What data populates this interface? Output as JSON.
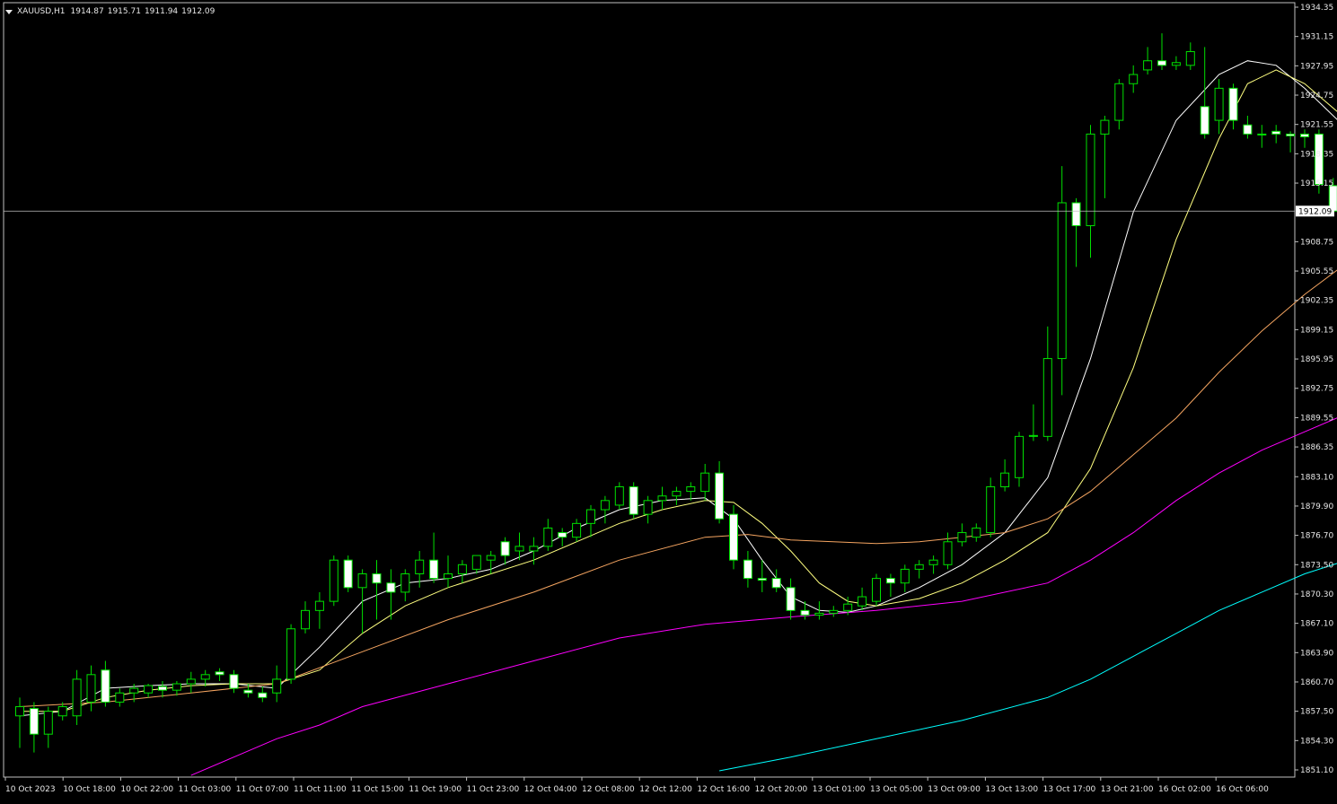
{
  "header": {
    "symbol": "XAUUSD,H1",
    "open": "1914.87",
    "high": "1915.71",
    "low": "1911.94",
    "close": "1912.09"
  },
  "colors": {
    "background": "#000000",
    "frame": "#c0c0c0",
    "bull_candle": "#00e000",
    "bear_candle_body": "#ffffff",
    "ma_fast": "#ffffff",
    "ma_slow": "#ffff80",
    "ma_50": "#f4a460",
    "ma_100": "#ff00ff",
    "ma_200": "#00ffff",
    "bid_line": "#c0c0c0"
  },
  "chart_data": {
    "type": "candlestick",
    "symbol": "XAUUSD",
    "timeframe": "H1",
    "ylim": [
      1851.1,
      1934.35
    ],
    "y_ticks": [
      "1934.35",
      "1931.15",
      "1927.95",
      "1924.75",
      "1921.55",
      "1918.35",
      "1915.15",
      "1912.09",
      "1908.75",
      "1905.55",
      "1902.35",
      "1899.15",
      "1895.95",
      "1892.75",
      "1889.55",
      "1886.35",
      "1883.10",
      "1879.90",
      "1876.70",
      "1873.50",
      "1870.30",
      "1867.10",
      "1863.90",
      "1860.70",
      "1857.50",
      "1854.30",
      "1851.10"
    ],
    "current_price": 1912.09,
    "x_labels": [
      "10 Oct 2023",
      "10 Oct 18:00",
      "10 Oct 22:00",
      "11 Oct 03:00",
      "11 Oct 07:00",
      "11 Oct 11:00",
      "11 Oct 15:00",
      "11 Oct 19:00",
      "11 Oct 23:00",
      "12 Oct 04:00",
      "12 Oct 08:00",
      "12 Oct 12:00",
      "12 Oct 16:00",
      "12 Oct 20:00",
      "13 Oct 01:00",
      "13 Oct 05:00",
      "13 Oct 09:00",
      "13 Oct 13:00",
      "13 Oct 17:00",
      "13 Oct 21:00",
      "16 Oct 02:00",
      "16 Oct 06:00"
    ],
    "candles": [
      {
        "o": 1857.0,
        "h": 1859.0,
        "l": 1853.5,
        "c": 1858.0
      },
      {
        "o": 1857.8,
        "h": 1858.5,
        "l": 1853.0,
        "c": 1855.0
      },
      {
        "o": 1855.0,
        "h": 1858.0,
        "l": 1853.5,
        "c": 1857.5
      },
      {
        "o": 1857.0,
        "h": 1858.5,
        "l": 1856.5,
        "c": 1858.0
      },
      {
        "o": 1857.0,
        "h": 1862.0,
        "l": 1856.0,
        "c": 1861.0
      },
      {
        "o": 1858.5,
        "h": 1862.5,
        "l": 1857.5,
        "c": 1861.5
      },
      {
        "o": 1862.0,
        "h": 1863.0,
        "l": 1858.0,
        "c": 1858.5
      },
      {
        "o": 1858.5,
        "h": 1860.0,
        "l": 1858.0,
        "c": 1859.5
      },
      {
        "o": 1859.5,
        "h": 1860.5,
        "l": 1858.5,
        "c": 1860.0
      },
      {
        "o": 1859.5,
        "h": 1860.5,
        "l": 1859.0,
        "c": 1860.3
      },
      {
        "o": 1860.2,
        "h": 1860.8,
        "l": 1859.0,
        "c": 1859.8
      },
      {
        "o": 1859.8,
        "h": 1860.8,
        "l": 1859.2,
        "c": 1860.5
      },
      {
        "o": 1860.5,
        "h": 1861.8,
        "l": 1859.5,
        "c": 1861.0
      },
      {
        "o": 1861.0,
        "h": 1862.0,
        "l": 1860.2,
        "c": 1861.5
      },
      {
        "o": 1861.8,
        "h": 1862.2,
        "l": 1860.8,
        "c": 1861.5
      },
      {
        "o": 1861.5,
        "h": 1862.0,
        "l": 1859.5,
        "c": 1860.0
      },
      {
        "o": 1859.8,
        "h": 1860.5,
        "l": 1859.0,
        "c": 1859.5
      },
      {
        "o": 1859.5,
        "h": 1860.2,
        "l": 1858.5,
        "c": 1859.0
      },
      {
        "o": 1859.5,
        "h": 1862.5,
        "l": 1858.5,
        "c": 1861.0
      },
      {
        "o": 1861.0,
        "h": 1867.0,
        "l": 1860.5,
        "c": 1866.5
      },
      {
        "o": 1866.5,
        "h": 1869.5,
        "l": 1866.0,
        "c": 1868.5
      },
      {
        "o": 1868.5,
        "h": 1870.5,
        "l": 1866.5,
        "c": 1869.5
      },
      {
        "o": 1869.5,
        "h": 1874.5,
        "l": 1869.0,
        "c": 1874.0
      },
      {
        "o": 1874.0,
        "h": 1874.5,
        "l": 1870.5,
        "c": 1871.0
      },
      {
        "o": 1871.0,
        "h": 1873.0,
        "l": 1866.0,
        "c": 1872.5
      },
      {
        "o": 1872.5,
        "h": 1874.0,
        "l": 1867.5,
        "c": 1871.5
      },
      {
        "o": 1871.5,
        "h": 1873.0,
        "l": 1867.5,
        "c": 1870.5
      },
      {
        "o": 1870.5,
        "h": 1873.0,
        "l": 1869.5,
        "c": 1872.5
      },
      {
        "o": 1872.5,
        "h": 1875.0,
        "l": 1871.0,
        "c": 1874.0
      },
      {
        "o": 1874.0,
        "h": 1877.0,
        "l": 1871.5,
        "c": 1872.0
      },
      {
        "o": 1872.0,
        "h": 1874.5,
        "l": 1871.0,
        "c": 1872.5
      },
      {
        "o": 1872.5,
        "h": 1874.0,
        "l": 1871.5,
        "c": 1873.5
      },
      {
        "o": 1873.0,
        "h": 1874.5,
        "l": 1872.5,
        "c": 1874.5
      },
      {
        "o": 1874.0,
        "h": 1875.0,
        "l": 1872.5,
        "c": 1874.5
      },
      {
        "o": 1876.0,
        "h": 1876.5,
        "l": 1873.5,
        "c": 1874.5
      },
      {
        "o": 1875.0,
        "h": 1877.0,
        "l": 1874.0,
        "c": 1875.5
      },
      {
        "o": 1875.0,
        "h": 1876.5,
        "l": 1873.5,
        "c": 1875.5
      },
      {
        "o": 1875.5,
        "h": 1878.5,
        "l": 1875.0,
        "c": 1877.5
      },
      {
        "o": 1877.0,
        "h": 1877.5,
        "l": 1875.5,
        "c": 1876.5
      },
      {
        "o": 1876.5,
        "h": 1878.5,
        "l": 1876.0,
        "c": 1878.0
      },
      {
        "o": 1878.0,
        "h": 1880.0,
        "l": 1876.5,
        "c": 1879.5
      },
      {
        "o": 1879.5,
        "h": 1881.0,
        "l": 1878.0,
        "c": 1880.5
      },
      {
        "o": 1880.0,
        "h": 1882.5,
        "l": 1879.5,
        "c": 1882.0
      },
      {
        "o": 1882.0,
        "h": 1882.5,
        "l": 1878.5,
        "c": 1879.0
      },
      {
        "o": 1879.0,
        "h": 1881.0,
        "l": 1878.0,
        "c": 1880.5
      },
      {
        "o": 1880.5,
        "h": 1882.0,
        "l": 1879.5,
        "c": 1881.0
      },
      {
        "o": 1881.0,
        "h": 1882.0,
        "l": 1880.0,
        "c": 1881.5
      },
      {
        "o": 1881.5,
        "h": 1882.5,
        "l": 1880.5,
        "c": 1882.0
      },
      {
        "o": 1881.5,
        "h": 1884.5,
        "l": 1880.5,
        "c": 1883.5
      },
      {
        "o": 1883.5,
        "h": 1884.8,
        "l": 1878.0,
        "c": 1878.5
      },
      {
        "o": 1879.0,
        "h": 1880.0,
        "l": 1873.0,
        "c": 1874.0
      },
      {
        "o": 1874.0,
        "h": 1875.0,
        "l": 1871.0,
        "c": 1872.0
      },
      {
        "o": 1872.0,
        "h": 1874.0,
        "l": 1870.5,
        "c": 1871.8
      },
      {
        "o": 1872.0,
        "h": 1873.0,
        "l": 1870.5,
        "c": 1871.0
      },
      {
        "o": 1871.0,
        "h": 1872.0,
        "l": 1867.5,
        "c": 1868.5
      },
      {
        "o": 1868.5,
        "h": 1869.5,
        "l": 1867.5,
        "c": 1868.0
      },
      {
        "o": 1868.0,
        "h": 1869.5,
        "l": 1867.5,
        "c": 1868.2
      },
      {
        "o": 1868.2,
        "h": 1869.0,
        "l": 1867.8,
        "c": 1868.5
      },
      {
        "o": 1868.5,
        "h": 1870.0,
        "l": 1868.0,
        "c": 1869.2
      },
      {
        "o": 1869.0,
        "h": 1871.0,
        "l": 1868.5,
        "c": 1870.0
      },
      {
        "o": 1869.5,
        "h": 1872.5,
        "l": 1869.0,
        "c": 1872.0
      },
      {
        "o": 1872.0,
        "h": 1872.5,
        "l": 1870.0,
        "c": 1871.5
      },
      {
        "o": 1871.5,
        "h": 1873.5,
        "l": 1870.5,
        "c": 1873.0
      },
      {
        "o": 1873.0,
        "h": 1874.0,
        "l": 1872.0,
        "c": 1873.5
      },
      {
        "o": 1873.5,
        "h": 1874.5,
        "l": 1872.5,
        "c": 1874.0
      },
      {
        "o": 1873.5,
        "h": 1877.0,
        "l": 1873.0,
        "c": 1876.0
      },
      {
        "o": 1876.0,
        "h": 1878.0,
        "l": 1875.5,
        "c": 1877.0
      },
      {
        "o": 1876.5,
        "h": 1878.0,
        "l": 1876.0,
        "c": 1877.5
      },
      {
        "o": 1877.0,
        "h": 1883.0,
        "l": 1876.5,
        "c": 1882.0
      },
      {
        "o": 1882.0,
        "h": 1885.0,
        "l": 1881.5,
        "c": 1883.5
      },
      {
        "o": 1883.0,
        "h": 1888.0,
        "l": 1882.0,
        "c": 1887.5
      },
      {
        "o": 1887.5,
        "h": 1891.0,
        "l": 1887.0,
        "c": 1887.6
      },
      {
        "o": 1887.5,
        "h": 1899.5,
        "l": 1887.0,
        "c": 1896.0
      },
      {
        "o": 1896.0,
        "h": 1917.0,
        "l": 1892.0,
        "c": 1913.0
      },
      {
        "o": 1913.0,
        "h": 1913.5,
        "l": 1906.0,
        "c": 1910.5
      },
      {
        "o": 1910.5,
        "h": 1921.5,
        "l": 1907.0,
        "c": 1920.5
      },
      {
        "o": 1920.5,
        "h": 1922.5,
        "l": 1913.5,
        "c": 1922.0
      },
      {
        "o": 1922.0,
        "h": 1926.5,
        "l": 1921.0,
        "c": 1926.0
      },
      {
        "o": 1926.0,
        "h": 1928.0,
        "l": 1925.0,
        "c": 1927.0
      },
      {
        "o": 1927.5,
        "h": 1930.0,
        "l": 1927.0,
        "c": 1928.5
      },
      {
        "o": 1928.5,
        "h": 1931.5,
        "l": 1927.5,
        "c": 1928.0
      },
      {
        "o": 1928.0,
        "h": 1929.0,
        "l": 1927.5,
        "c": 1928.3
      },
      {
        "o": 1928.0,
        "h": 1930.5,
        "l": 1927.5,
        "c": 1929.5
      },
      {
        "o": 1923.5,
        "h": 1930.0,
        "l": 1920.0,
        "c": 1920.5
      },
      {
        "o": 1922.0,
        "h": 1926.5,
        "l": 1920.5,
        "c": 1925.5
      },
      {
        "o": 1925.5,
        "h": 1926.0,
        "l": 1921.0,
        "c": 1922.0
      },
      {
        "o": 1921.5,
        "h": 1922.5,
        "l": 1920.0,
        "c": 1920.5
      },
      {
        "o": 1920.5,
        "h": 1921.5,
        "l": 1919.0,
        "c": 1920.5
      },
      {
        "o": 1920.8,
        "h": 1921.5,
        "l": 1919.5,
        "c": 1920.5
      },
      {
        "o": 1920.5,
        "h": 1920.8,
        "l": 1918.5,
        "c": 1920.3
      },
      {
        "o": 1920.5,
        "h": 1921.0,
        "l": 1919.0,
        "c": 1920.2
      },
      {
        "o": 1920.5,
        "h": 1921.0,
        "l": 1914.0,
        "c": 1915.0
      },
      {
        "o": 1914.87,
        "h": 1915.71,
        "l": 1911.94,
        "c": 1912.09
      }
    ],
    "moving_averages": [
      {
        "color": "#ffffff",
        "x": [
          0,
          3,
          6,
          9,
          12,
          15,
          18,
          21,
          24,
          27,
          30,
          33,
          36,
          39,
          42,
          45,
          48,
          50,
          52,
          54,
          56,
          58,
          60,
          63,
          66,
          69,
          72,
          75,
          78,
          81,
          84,
          86,
          88,
          90,
          93
        ],
        "y": [
          1857.0,
          1857.5,
          1860.0,
          1860.3,
          1860.5,
          1860.5,
          1860.0,
          1864.5,
          1869.5,
          1871.5,
          1872.0,
          1873.0,
          1875.0,
          1877.5,
          1879.5,
          1880.5,
          1880.8,
          1878.5,
          1874.0,
          1870.0,
          1868.5,
          1868.3,
          1869.0,
          1871.0,
          1873.5,
          1877.0,
          1883.0,
          1896.0,
          1912.0,
          1922.0,
          1927.0,
          1928.5,
          1928.0,
          1925.5,
          1921.0
        ]
      },
      {
        "color": "#ffff80",
        "x": [
          0,
          3,
          6,
          9,
          12,
          15,
          18,
          21,
          24,
          27,
          30,
          33,
          36,
          39,
          42,
          45,
          48,
          50,
          52,
          54,
          56,
          58,
          60,
          63,
          66,
          69,
          72,
          75,
          78,
          81,
          84,
          86,
          88,
          90,
          93
        ],
        "y": [
          1857.5,
          1857.5,
          1859.0,
          1859.8,
          1860.3,
          1860.5,
          1860.5,
          1862.0,
          1866.0,
          1869.0,
          1871.0,
          1872.5,
          1874.0,
          1876.0,
          1878.0,
          1879.5,
          1880.5,
          1880.3,
          1878.0,
          1875.0,
          1871.5,
          1869.5,
          1869.0,
          1869.8,
          1871.5,
          1874.0,
          1877.0,
          1884.0,
          1895.0,
          1909.0,
          1920.0,
          1926.0,
          1927.5,
          1926.0,
          1922.0
        ]
      },
      {
        "color": "#f4a460",
        "x": [
          0,
          6,
          12,
          18,
          24,
          30,
          36,
          42,
          48,
          51,
          54,
          57,
          60,
          63,
          66,
          69,
          72,
          75,
          78,
          81,
          84,
          87,
          90,
          93
        ],
        "y": [
          1858.0,
          1858.5,
          1859.5,
          1860.5,
          1864.0,
          1867.5,
          1870.5,
          1874.0,
          1876.5,
          1876.8,
          1876.2,
          1876.0,
          1875.8,
          1876.0,
          1876.5,
          1877.0,
          1878.5,
          1881.5,
          1885.5,
          1889.5,
          1894.5,
          1899.0,
          1903.0,
          1906.5
        ]
      },
      {
        "color": "#ff00ff",
        "x": [
          12,
          15,
          18,
          21,
          24,
          30,
          36,
          42,
          48,
          54,
          60,
          66,
          72,
          75,
          78,
          81,
          84,
          87,
          90,
          93
        ],
        "y": [
          1850.5,
          1852.5,
          1854.5,
          1856.0,
          1858.0,
          1860.5,
          1863.0,
          1865.5,
          1867.0,
          1867.8,
          1868.5,
          1869.5,
          1871.5,
          1874.0,
          1877.0,
          1880.5,
          1883.5,
          1886.0,
          1888.0,
          1890.0
        ]
      },
      {
        "color": "#00ffff",
        "x": [
          49,
          54,
          60,
          66,
          72,
          75,
          78,
          81,
          84,
          87,
          90,
          93
        ],
        "y": [
          1851.0,
          1852.5,
          1854.5,
          1856.5,
          1859.0,
          1861.0,
          1863.5,
          1866.0,
          1868.5,
          1870.5,
          1872.5,
          1874.0
        ]
      }
    ]
  }
}
